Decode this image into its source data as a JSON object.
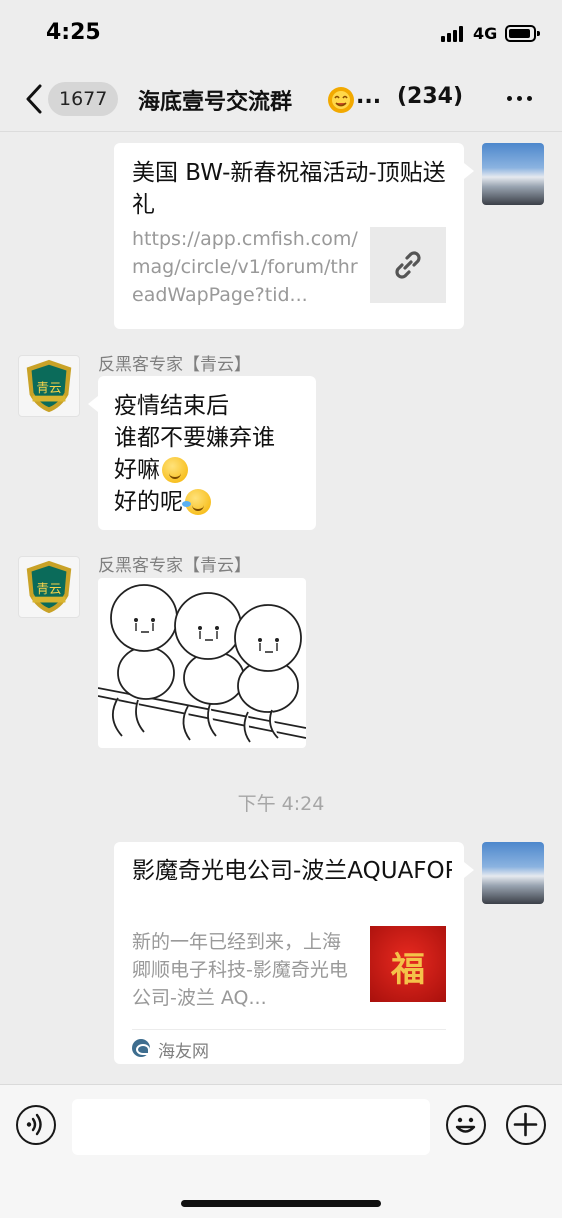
{
  "status_bar": {
    "time": "4:25",
    "network": "4G"
  },
  "nav": {
    "unread_count": "1677",
    "group_name": "海底壹号交流群",
    "title_ellipsis": "...",
    "member_count": "(234)"
  },
  "messages": [
    {
      "type": "link",
      "from": "self",
      "title": "美国 BW-新春祝福活动-顶贴送礼",
      "url": "https://app.cmfish.com/mag/circle/v1/forum/threadWapPage?tid..."
    },
    {
      "type": "text",
      "from": "other",
      "sender": "反黑客专家【青云】",
      "lines": [
        "疫情结束后",
        "谁都不要嫌弃谁",
        "好嘛",
        "好的呢"
      ]
    },
    {
      "type": "sticker",
      "from": "other",
      "sender": "反黑客专家【青云】"
    },
    {
      "type": "timestamp",
      "text": "下午 4:24"
    },
    {
      "type": "article",
      "from": "self",
      "title": "影魔奇光电公司-波兰AQUAFOREST-新春祝福...",
      "description": "新的一年已经到来，上海卿顺电子科技-影魔奇光电公司-波兰 AQ...",
      "thumb_text": "福",
      "source": "海友网"
    }
  ],
  "input_bar": {
    "placeholder": ""
  },
  "colors": {
    "background": "#ededed",
    "bubble": "#ffffff",
    "muted_text": "#999999"
  }
}
